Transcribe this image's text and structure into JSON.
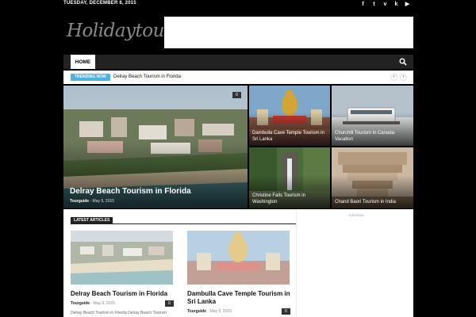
{
  "topbar": {
    "date": "TUESDAY, DECEMBER 8, 2015",
    "social_icons": [
      "facebook-icon",
      "twitter-icon",
      "vimeo-icon",
      "vk-icon",
      "youtube-icon"
    ]
  },
  "header": {
    "logo_text": "Holidaytouristic"
  },
  "nav": {
    "home": "HOME",
    "search_icon": "search-icon"
  },
  "trending": {
    "badge": "TRENDING NOW",
    "text": "Delray Beach Tourism in Florida",
    "prev_icon": "chevron-left-icon",
    "next_icon": "chevron-right-icon"
  },
  "featured": {
    "main": {
      "title": "Delray Beach Tourism in Florida",
      "author": "Tourguide",
      "date": "May 9, 2015",
      "comments": "0"
    },
    "tiles": [
      {
        "title": "Dambulla Cave Temple Tourism in Sri Lanka"
      },
      {
        "title": "Churchill Tourism in Canada Vacation"
      },
      {
        "title": "Christine Falls Tourism in Washington"
      },
      {
        "title": "Chand Baori Tourism in India"
      }
    ]
  },
  "latest": {
    "heading": "LATEST ARTICLES",
    "articles": [
      {
        "title": "Delray Beach Tourism in Florida",
        "author": "Tourguide",
        "date": "May 9, 2015",
        "comments": "0",
        "excerpt": "Delray Beach Tourism in Florida Delray Beach Tourism"
      },
      {
        "title": "Dambulla Cave Temple Tourism in Sri Lanka",
        "author": "Tourguide",
        "date": "May 9, 2015",
        "comments": "0"
      }
    ]
  },
  "sidebar": {
    "advertise": "- Advertise -"
  },
  "colors": {
    "accent": "#4db2ec",
    "nav_bg": "#222222",
    "page_bg": "#000000"
  }
}
